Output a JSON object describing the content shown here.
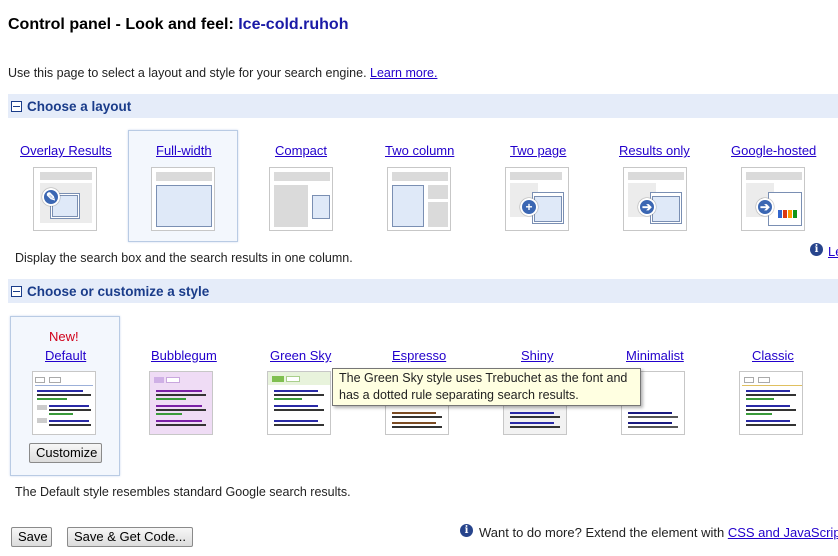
{
  "header": {
    "title_prefix": "Control panel - Look and feel: ",
    "engine_name": "Ice-cold.ruhoh"
  },
  "intro": {
    "text": "Use this page to select a layout and style for your search engine. ",
    "link": "Learn more."
  },
  "layout_section": {
    "title": "Choose a layout",
    "options": [
      {
        "label": "Overlay Results"
      },
      {
        "label": "Full-width"
      },
      {
        "label": "Compact"
      },
      {
        "label": "Two column"
      },
      {
        "label": "Two page"
      },
      {
        "label": "Results only"
      },
      {
        "label": "Google-hosted"
      }
    ],
    "selected": "Full-width",
    "description": "Display the search box and the search results in one column.",
    "right_link_fragment": "Le"
  },
  "style_section": {
    "title": "Choose or customize a style",
    "new_badge": "New!",
    "options": [
      {
        "label": "Default"
      },
      {
        "label": "Bubblegum"
      },
      {
        "label": "Green Sky"
      },
      {
        "label": "Espresso"
      },
      {
        "label": "Shiny"
      },
      {
        "label": "Minimalist"
      },
      {
        "label": "Classic"
      }
    ],
    "selected": "Default",
    "customize_label": "Customize",
    "description": "The Default style resembles standard Google search results.",
    "tooltip": "The Green Sky style uses Trebuchet as the font and has a dotted rule separating search results."
  },
  "footer": {
    "save_label": "Save",
    "save_get_code_label": "Save & Get Code...",
    "more_text": "Want to do more? Extend the element with ",
    "more_link": "CSS and JavaScript"
  },
  "colors": {
    "section_bg": "#e5ecf9",
    "section_text": "#1a3c8a",
    "link": "#2200cc",
    "tooltip_bg": "#ffffe1",
    "new_badge": "#d0021b"
  }
}
